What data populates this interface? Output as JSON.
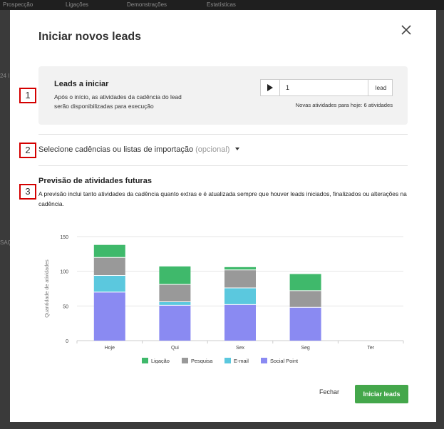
{
  "nav": {
    "items": [
      "Prospecção",
      "Ligações",
      "Demonstrações",
      "Estatísticas"
    ]
  },
  "background": {
    "left_text_1": "24 I",
    "left_text_2": "SAÇ"
  },
  "modal": {
    "title": "Iniciar novos leads",
    "leads": {
      "heading": "Leads a iniciar",
      "description": "Após o início, as atividades da cadência do lead serão disponibilizadas para execução",
      "quantity": "1",
      "unit": "lead",
      "today_activities": "Novas atividades para hoje: 6 atividades"
    },
    "markers": [
      "1",
      "2",
      "3"
    ],
    "cadence_select": {
      "label": "Selecione cadências ou listas de importação",
      "optional": "(opcional)"
    },
    "forecast": {
      "heading": "Previsão de atividades futuras",
      "description": "A previsão inclui tanto atividades da cadência quanto extras e é atualizada sempre que houver leads iniciados, finalizados ou alterações na cadência."
    },
    "buttons": {
      "close": "Fechar",
      "start": "Iniciar leads"
    }
  },
  "chart_data": {
    "type": "bar",
    "stacked": true,
    "categories": [
      "Hoje",
      "Qui",
      "Sex",
      "Seg",
      "Ter"
    ],
    "series": [
      {
        "name": "Social Point",
        "color": "#8a8af2",
        "values": [
          70,
          51,
          52,
          48,
          0
        ]
      },
      {
        "name": "E-mail",
        "color": "#5bc8de",
        "values": [
          24,
          5,
          24,
          0,
          0
        ]
      },
      {
        "name": "Pesquisa",
        "color": "#999999",
        "values": [
          26,
          25,
          26,
          24,
          0
        ]
      },
      {
        "name": "Ligação",
        "color": "#3fb96b",
        "values": [
          18,
          26,
          4,
          24,
          0
        ]
      }
    ],
    "ylabel": "Quantidade de atividades",
    "yticks": [
      0,
      50,
      100,
      150
    ],
    "ylim": [
      0,
      150
    ],
    "legend_order": [
      "Ligação",
      "Pesquisa",
      "E-mail",
      "Social Point"
    ],
    "legend_position": "bottom",
    "grid": true
  }
}
